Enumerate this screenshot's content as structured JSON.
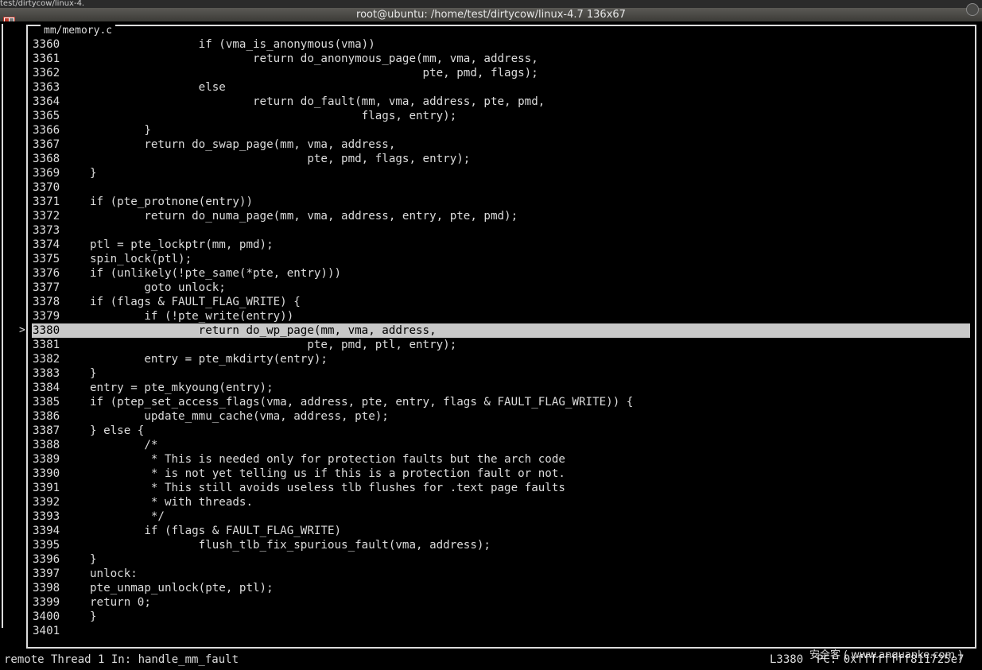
{
  "window": {
    "title": "root@ubuntu: /home/test/dirtycow/linux-4.7 136x67",
    "bg_partial_text": "test/dirtycow/linux-4."
  },
  "colors": {
    "background": "#000000",
    "foreground": "#dcdcdc",
    "highlight": "#c8c8c8",
    "titlebar": "#3c3b37"
  },
  "icons": {
    "window": "terminal-window-icon",
    "close": "close-icon"
  },
  "source_pane": {
    "filename": "mm/memory.c",
    "current_line_marker": ">",
    "current_line": "3380",
    "lines": [
      {
        "num": "3360",
        "code": "                if (vma_is_anonymous(vma))"
      },
      {
        "num": "3361",
        "code": "                        return do_anonymous_page(mm, vma, address,"
      },
      {
        "num": "3362",
        "code": "                                                 pte, pmd, flags);"
      },
      {
        "num": "3363",
        "code": "                else"
      },
      {
        "num": "3364",
        "code": "                        return do_fault(mm, vma, address, pte, pmd,"
      },
      {
        "num": "3365",
        "code": "                                        flags, entry);"
      },
      {
        "num": "3366",
        "code": "        }"
      },
      {
        "num": "3367",
        "code": "        return do_swap_page(mm, vma, address,"
      },
      {
        "num": "3368",
        "code": "                                pte, pmd, flags, entry);"
      },
      {
        "num": "3369",
        "code": "}"
      },
      {
        "num": "3370",
        "code": ""
      },
      {
        "num": "3371",
        "code": "if (pte_protnone(entry))"
      },
      {
        "num": "3372",
        "code": "        return do_numa_page(mm, vma, address, entry, pte, pmd);"
      },
      {
        "num": "3373",
        "code": ""
      },
      {
        "num": "3374",
        "code": "ptl = pte_lockptr(mm, pmd);"
      },
      {
        "num": "3375",
        "code": "spin_lock(ptl);"
      },
      {
        "num": "3376",
        "code": "if (unlikely(!pte_same(*pte, entry)))"
      },
      {
        "num": "3377",
        "code": "        goto unlock;"
      },
      {
        "num": "3378",
        "code": "if (flags & FAULT_FLAG_WRITE) {"
      },
      {
        "num": "3379",
        "code": "        if (!pte_write(entry))"
      },
      {
        "num": "3380",
        "code": "                return do_wp_page(mm, vma, address,"
      },
      {
        "num": "3381",
        "code": "                                pte, pmd, ptl, entry);"
      },
      {
        "num": "3382",
        "code": "        entry = pte_mkdirty(entry);"
      },
      {
        "num": "3383",
        "code": "}"
      },
      {
        "num": "3384",
        "code": "entry = pte_mkyoung(entry);"
      },
      {
        "num": "3385",
        "code": "if (ptep_set_access_flags(vma, address, pte, entry, flags & FAULT_FLAG_WRITE)) {"
      },
      {
        "num": "3386",
        "code": "        update_mmu_cache(vma, address, pte);"
      },
      {
        "num": "3387",
        "code": "} else {"
      },
      {
        "num": "3388",
        "code": "        /*"
      },
      {
        "num": "3389",
        "code": "         * This is needed only for protection faults but the arch code"
      },
      {
        "num": "3390",
        "code": "         * is not yet telling us if this is a protection fault or not."
      },
      {
        "num": "3391",
        "code": "         * This still avoids useless tlb flushes for .text page faults"
      },
      {
        "num": "3392",
        "code": "         * with threads."
      },
      {
        "num": "3393",
        "code": "         */"
      },
      {
        "num": "3394",
        "code": "        if (flags & FAULT_FLAG_WRITE)"
      },
      {
        "num": "3395",
        "code": "                flush_tlb_fix_spurious_fault(vma, address);"
      },
      {
        "num": "3396",
        "code": "}"
      },
      {
        "num": "3397",
        "code": "unlock:"
      },
      {
        "num": "3398",
        "code": "pte_unmap_unlock(pte, ptl);"
      },
      {
        "num": "3399",
        "code": "return 0;"
      },
      {
        "num": "3400",
        "code": "}"
      },
      {
        "num": "3401",
        "code": ""
      }
    ]
  },
  "status": {
    "left": "remote Thread 1 In: handle_mm_fault",
    "right": "L3380  PC: 0xffffffff811725e7"
  },
  "watermark": "安全客 ( www.anquanke.com )"
}
